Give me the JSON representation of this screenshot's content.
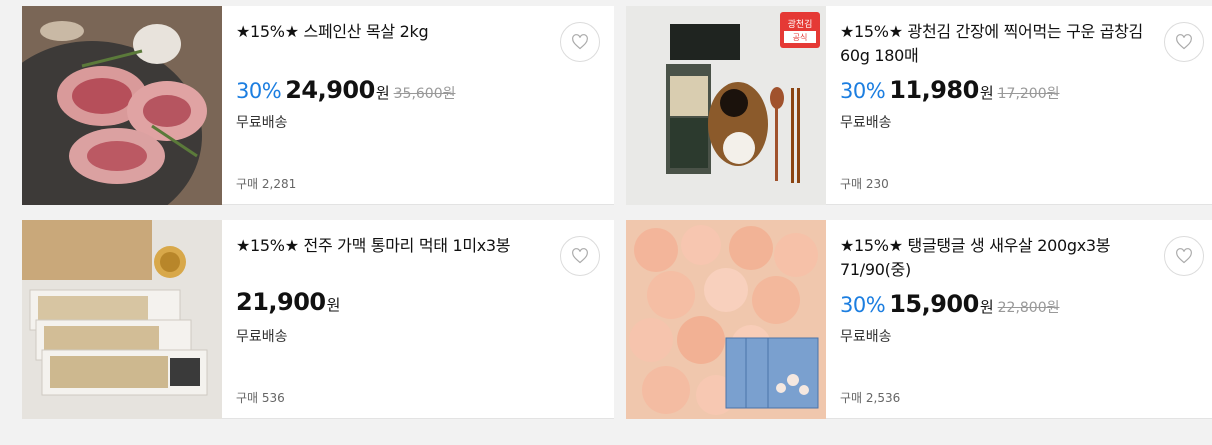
{
  "products": [
    {
      "title": "★15%★ 스페인산 목살 2kg",
      "discount": "30%",
      "price": "24,900",
      "currency": "원",
      "original_price": "35,600원",
      "shipping": "무료배송",
      "purchases": "구매 2,281",
      "image": "pork-neck-photo"
    },
    {
      "title": "★15%★ 광천김 간장에 찍어먹는 구운 곱창김 60g 180매",
      "discount": "30%",
      "price": "11,980",
      "currency": "원",
      "original_price": "17,200원",
      "shipping": "무료배송",
      "purchases": "구매 230",
      "image": "seaweed-photo",
      "badge": [
        "광천김",
        "공식"
      ]
    },
    {
      "title": "★15%★ 전주 가맥 통마리 먹태 1미x3봉",
      "discount": "",
      "price": "21,900",
      "currency": "원",
      "original_price": "",
      "shipping": "무료배송",
      "purchases": "구매 536",
      "image": "dried-pollack-photo"
    },
    {
      "title": "★15%★ 탱글탱글 생 새우살 200gx3봉 71/90(중)",
      "discount": "30%",
      "price": "15,900",
      "currency": "원",
      "original_price": "22,800원",
      "shipping": "무료배송",
      "purchases": "구매 2,536",
      "image": "shrimp-photo"
    }
  ],
  "icons": {
    "wishlist": "heart-outline-icon"
  },
  "colors": {
    "discount": "#1c7ee0",
    "page_background": "#f2f2f2",
    "strike_price": "#999999"
  }
}
